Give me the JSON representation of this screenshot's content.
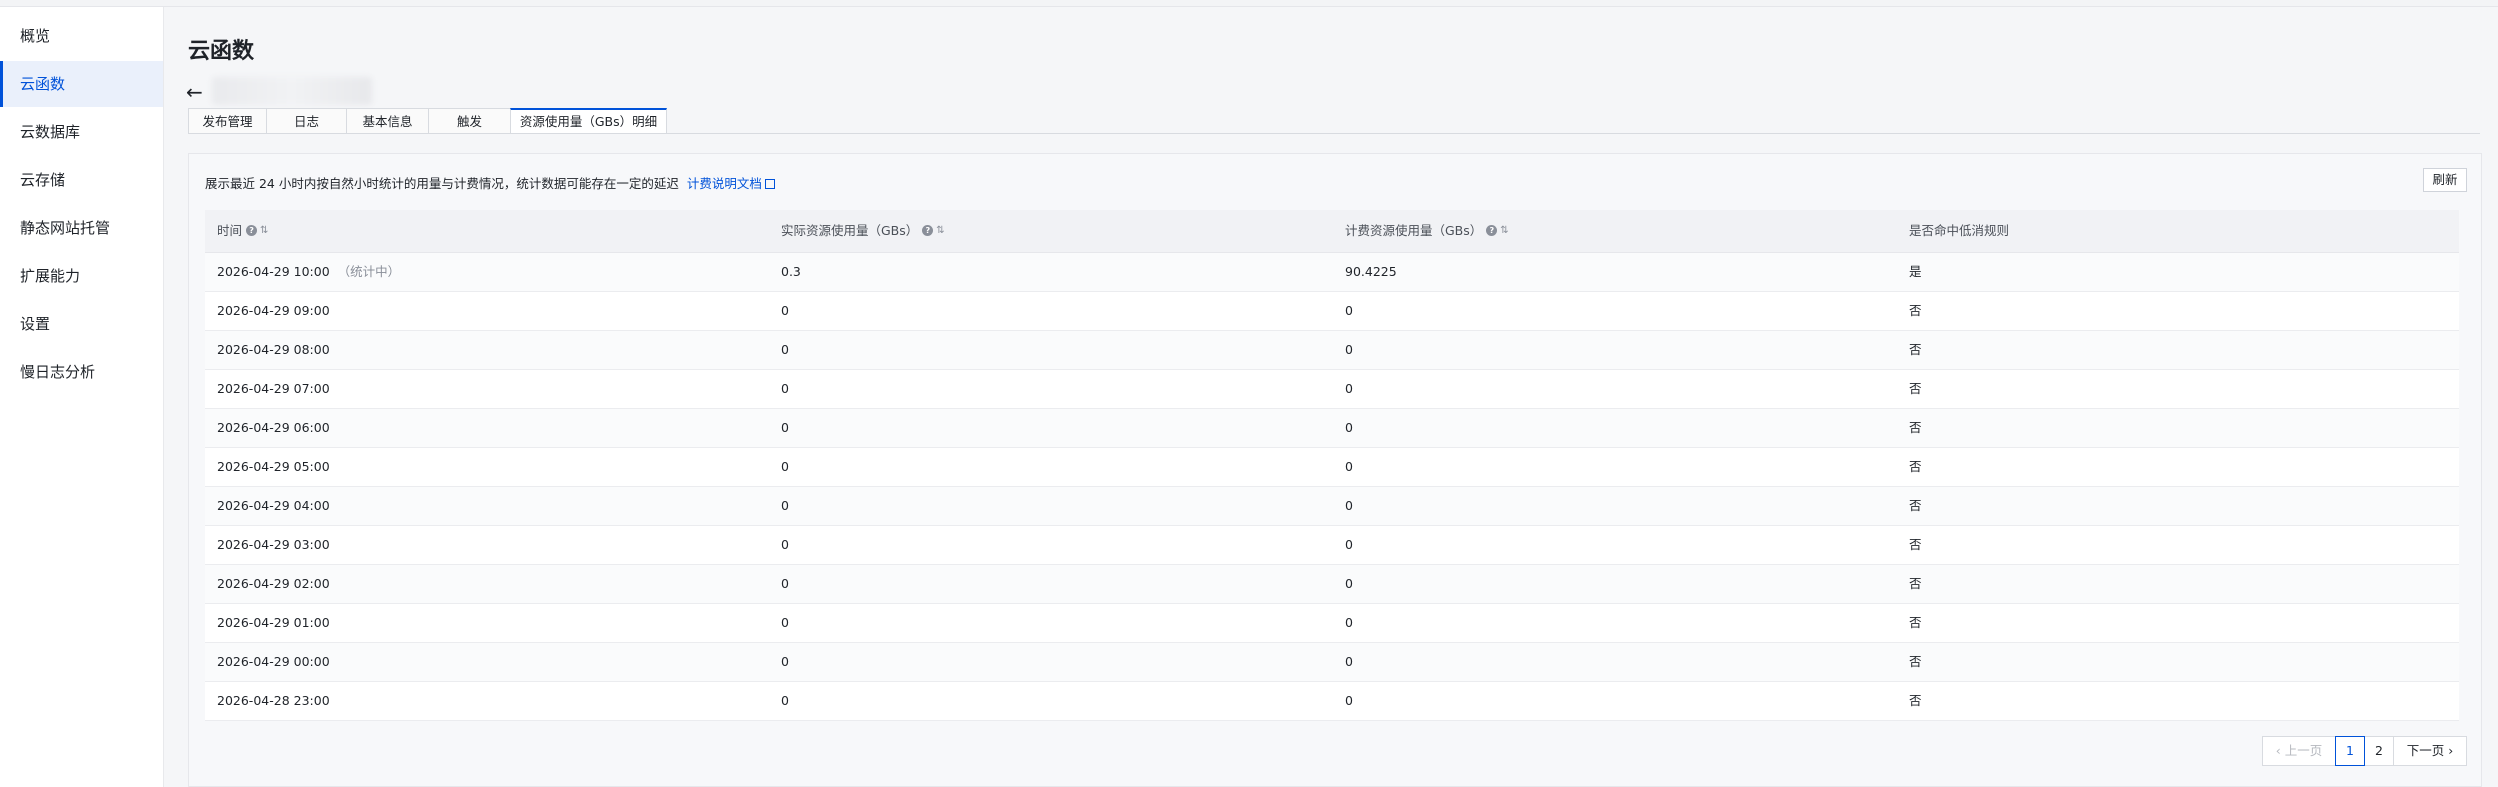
{
  "sidebar": {
    "items": [
      {
        "label": "概览"
      },
      {
        "label": "云函数"
      },
      {
        "label": "云数据库"
      },
      {
        "label": "云存储"
      },
      {
        "label": "静态网站托管"
      },
      {
        "label": "扩展能力"
      },
      {
        "label": "设置"
      },
      {
        "label": "慢日志分析"
      }
    ],
    "active_index": 1
  },
  "header": {
    "title": "云函数",
    "back_icon": "←"
  },
  "tabs": [
    {
      "label": "发布管理"
    },
    {
      "label": "日志"
    },
    {
      "label": "基本信息"
    },
    {
      "label": "触发"
    },
    {
      "label": "资源使用量（GBs）明细"
    }
  ],
  "card": {
    "description": "展示最近 24 小时内按自然小时统计的用量与计费情况，统计数据可能存在一定的延迟",
    "doc_link": "计费说明文档",
    "refresh": "刷新"
  },
  "table": {
    "columns": [
      "时间",
      "实际资源使用量（GBs）",
      "计费资源使用量（GBs）",
      "是否命中低消规则"
    ],
    "rows": [
      {
        "time": "2026-04-29 10:00",
        "note": "（统计中）",
        "actual": "0.3",
        "billed": "90.4225",
        "low": "是"
      },
      {
        "time": "2026-04-29 09:00",
        "note": "",
        "actual": "0",
        "billed": "0",
        "low": "否"
      },
      {
        "time": "2026-04-29 08:00",
        "note": "",
        "actual": "0",
        "billed": "0",
        "low": "否"
      },
      {
        "time": "2026-04-29 07:00",
        "note": "",
        "actual": "0",
        "billed": "0",
        "low": "否"
      },
      {
        "time": "2026-04-29 06:00",
        "note": "",
        "actual": "0",
        "billed": "0",
        "low": "否"
      },
      {
        "time": "2026-04-29 05:00",
        "note": "",
        "actual": "0",
        "billed": "0",
        "low": "否"
      },
      {
        "time": "2026-04-29 04:00",
        "note": "",
        "actual": "0",
        "billed": "0",
        "low": "否"
      },
      {
        "time": "2026-04-29 03:00",
        "note": "",
        "actual": "0",
        "billed": "0",
        "low": "否"
      },
      {
        "time": "2026-04-29 02:00",
        "note": "",
        "actual": "0",
        "billed": "0",
        "low": "否"
      },
      {
        "time": "2026-04-29 01:00",
        "note": "",
        "actual": "0",
        "billed": "0",
        "low": "否"
      },
      {
        "time": "2026-04-29 00:00",
        "note": "",
        "actual": "0",
        "billed": "0",
        "low": "否"
      },
      {
        "time": "2026-04-28 23:00",
        "note": "",
        "actual": "0",
        "billed": "0",
        "low": "否"
      }
    ]
  },
  "pagination": {
    "prev": "上一页",
    "pages": [
      "1",
      "2"
    ],
    "current": "1",
    "next": "下一页"
  },
  "colors": {
    "accent": "#0052d9",
    "sidebar_active_bg": "#eaf0fb"
  }
}
